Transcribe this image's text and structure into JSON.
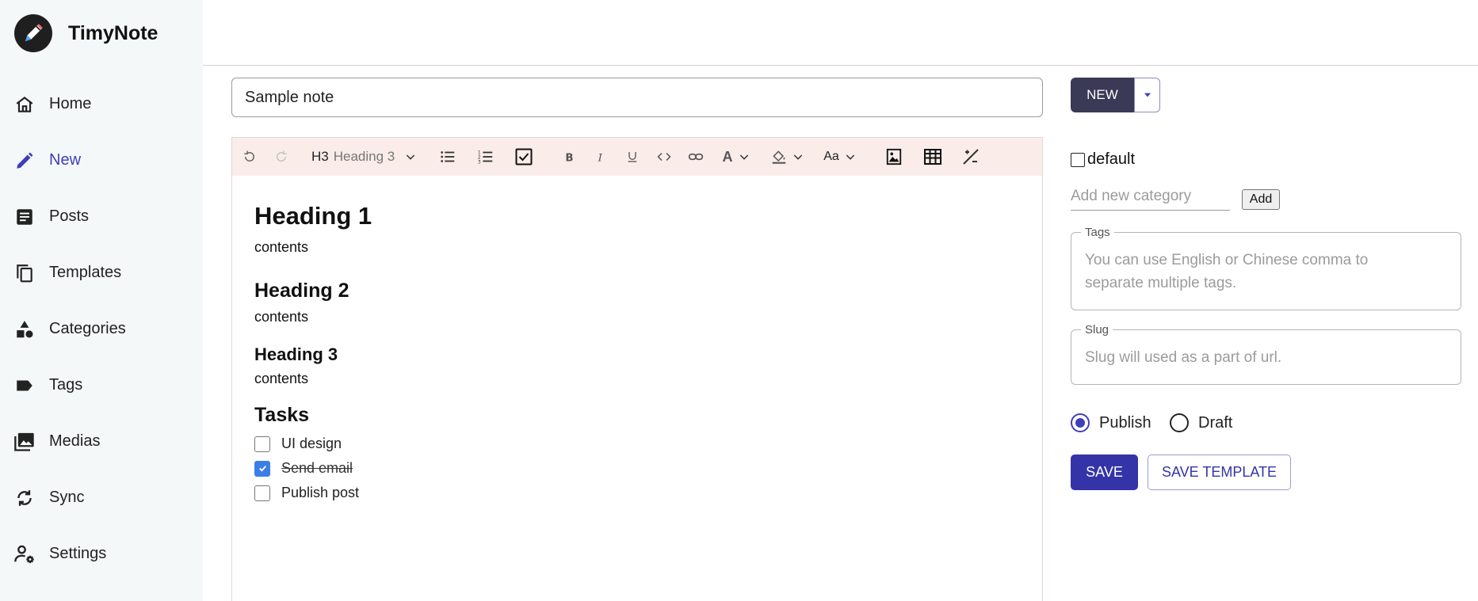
{
  "brand": {
    "name": "TimyNote",
    "logo_icon": "pen-icon"
  },
  "sidebar": {
    "active": "New",
    "active_color": "#3f3fb8",
    "items": [
      {
        "label": "Home",
        "icon": "home-icon"
      },
      {
        "label": "New",
        "icon": "pencil-icon"
      },
      {
        "label": "Posts",
        "icon": "article-icon"
      },
      {
        "label": "Templates",
        "icon": "copy-icon"
      },
      {
        "label": "Categories",
        "icon": "shapes-icon"
      },
      {
        "label": "Tags",
        "icon": "label-icon"
      },
      {
        "label": "Medias",
        "icon": "photo-library-icon"
      },
      {
        "label": "Sync",
        "icon": "sync-icon"
      },
      {
        "label": "Settings",
        "icon": "manage-accounts-icon"
      }
    ]
  },
  "note": {
    "title": "Sample note"
  },
  "toolbar": {
    "heading_tag": "H3",
    "heading_name": "Heading 3",
    "font_size_label": "Aa",
    "color_label": "A",
    "bg_color": "#f9ece9"
  },
  "content": {
    "h1": "Heading 1",
    "p1": "contents",
    "h2": "Heading 2",
    "p2": "contents",
    "h3": "Heading 3",
    "p3": "contents",
    "tasks_heading": "Tasks",
    "tasks": [
      {
        "label": "UI design",
        "checked": false
      },
      {
        "label": "Send email",
        "checked": true
      },
      {
        "label": "Publish post",
        "checked": false
      }
    ]
  },
  "actions": {
    "new_label": "NEW"
  },
  "categories": {
    "items": [
      {
        "label": "default",
        "checked": false
      }
    ],
    "add_placeholder": "Add new category",
    "add_label": "Add"
  },
  "tags": {
    "legend": "Tags",
    "placeholder_line1": "You can use English or Chinese comma to",
    "placeholder_line2": "separate multiple tags."
  },
  "slug": {
    "legend": "Slug",
    "placeholder": "Slug will used as a part of url."
  },
  "status": {
    "options": [
      {
        "label": "Publish",
        "selected": true
      },
      {
        "label": "Draft",
        "selected": false
      }
    ]
  },
  "buttons": {
    "save": "SAVE",
    "save_template": "SAVE TEMPLATE"
  },
  "colors": {
    "primary": "#3434a8",
    "dark_button": "#3a3a56",
    "checkbox_checked": "#3b7ee8"
  }
}
